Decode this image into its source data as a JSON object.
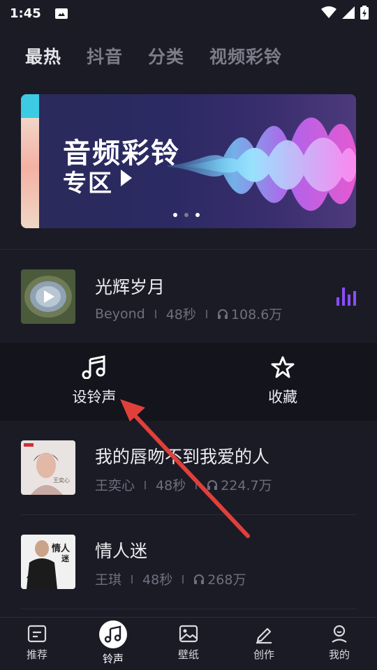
{
  "status_bar": {
    "time": "1:45"
  },
  "tabs": [
    {
      "label": "最热",
      "active": true
    },
    {
      "label": "抖音",
      "active": false
    },
    {
      "label": "分类",
      "active": false
    },
    {
      "label": "视频彩铃",
      "active": false
    }
  ],
  "banner": {
    "title_line1": "音频彩铃",
    "title_line2": "专区",
    "dots": 3,
    "active_dot": 0
  },
  "songs": [
    {
      "title": "光辉岁月",
      "artist": "Beyond",
      "duration": "48秒",
      "plays": "108.6万",
      "playing": true
    },
    {
      "title": "我的唇吻不到我爱的人",
      "artist": "王奕心",
      "duration": "48秒",
      "plays": "224.7万",
      "playing": false
    },
    {
      "title": "情人迷",
      "artist": "王琪",
      "duration": "48秒",
      "plays": "268万",
      "playing": false
    }
  ],
  "actions": {
    "set_ringtone": "设铃声",
    "favorite": "收藏"
  },
  "bottom_nav": [
    {
      "label": "推荐",
      "icon": "recommend-icon",
      "active": false
    },
    {
      "label": "铃声",
      "icon": "music-note-icon",
      "active": true
    },
    {
      "label": "壁纸",
      "icon": "wallpaper-icon",
      "active": false
    },
    {
      "label": "创作",
      "icon": "pencil-icon",
      "active": false
    },
    {
      "label": "我的",
      "icon": "profile-icon",
      "active": false
    }
  ],
  "colors": {
    "background": "#1b1b26",
    "accent_purple": "#8b4dff",
    "annotation_arrow": "#e0403a"
  }
}
